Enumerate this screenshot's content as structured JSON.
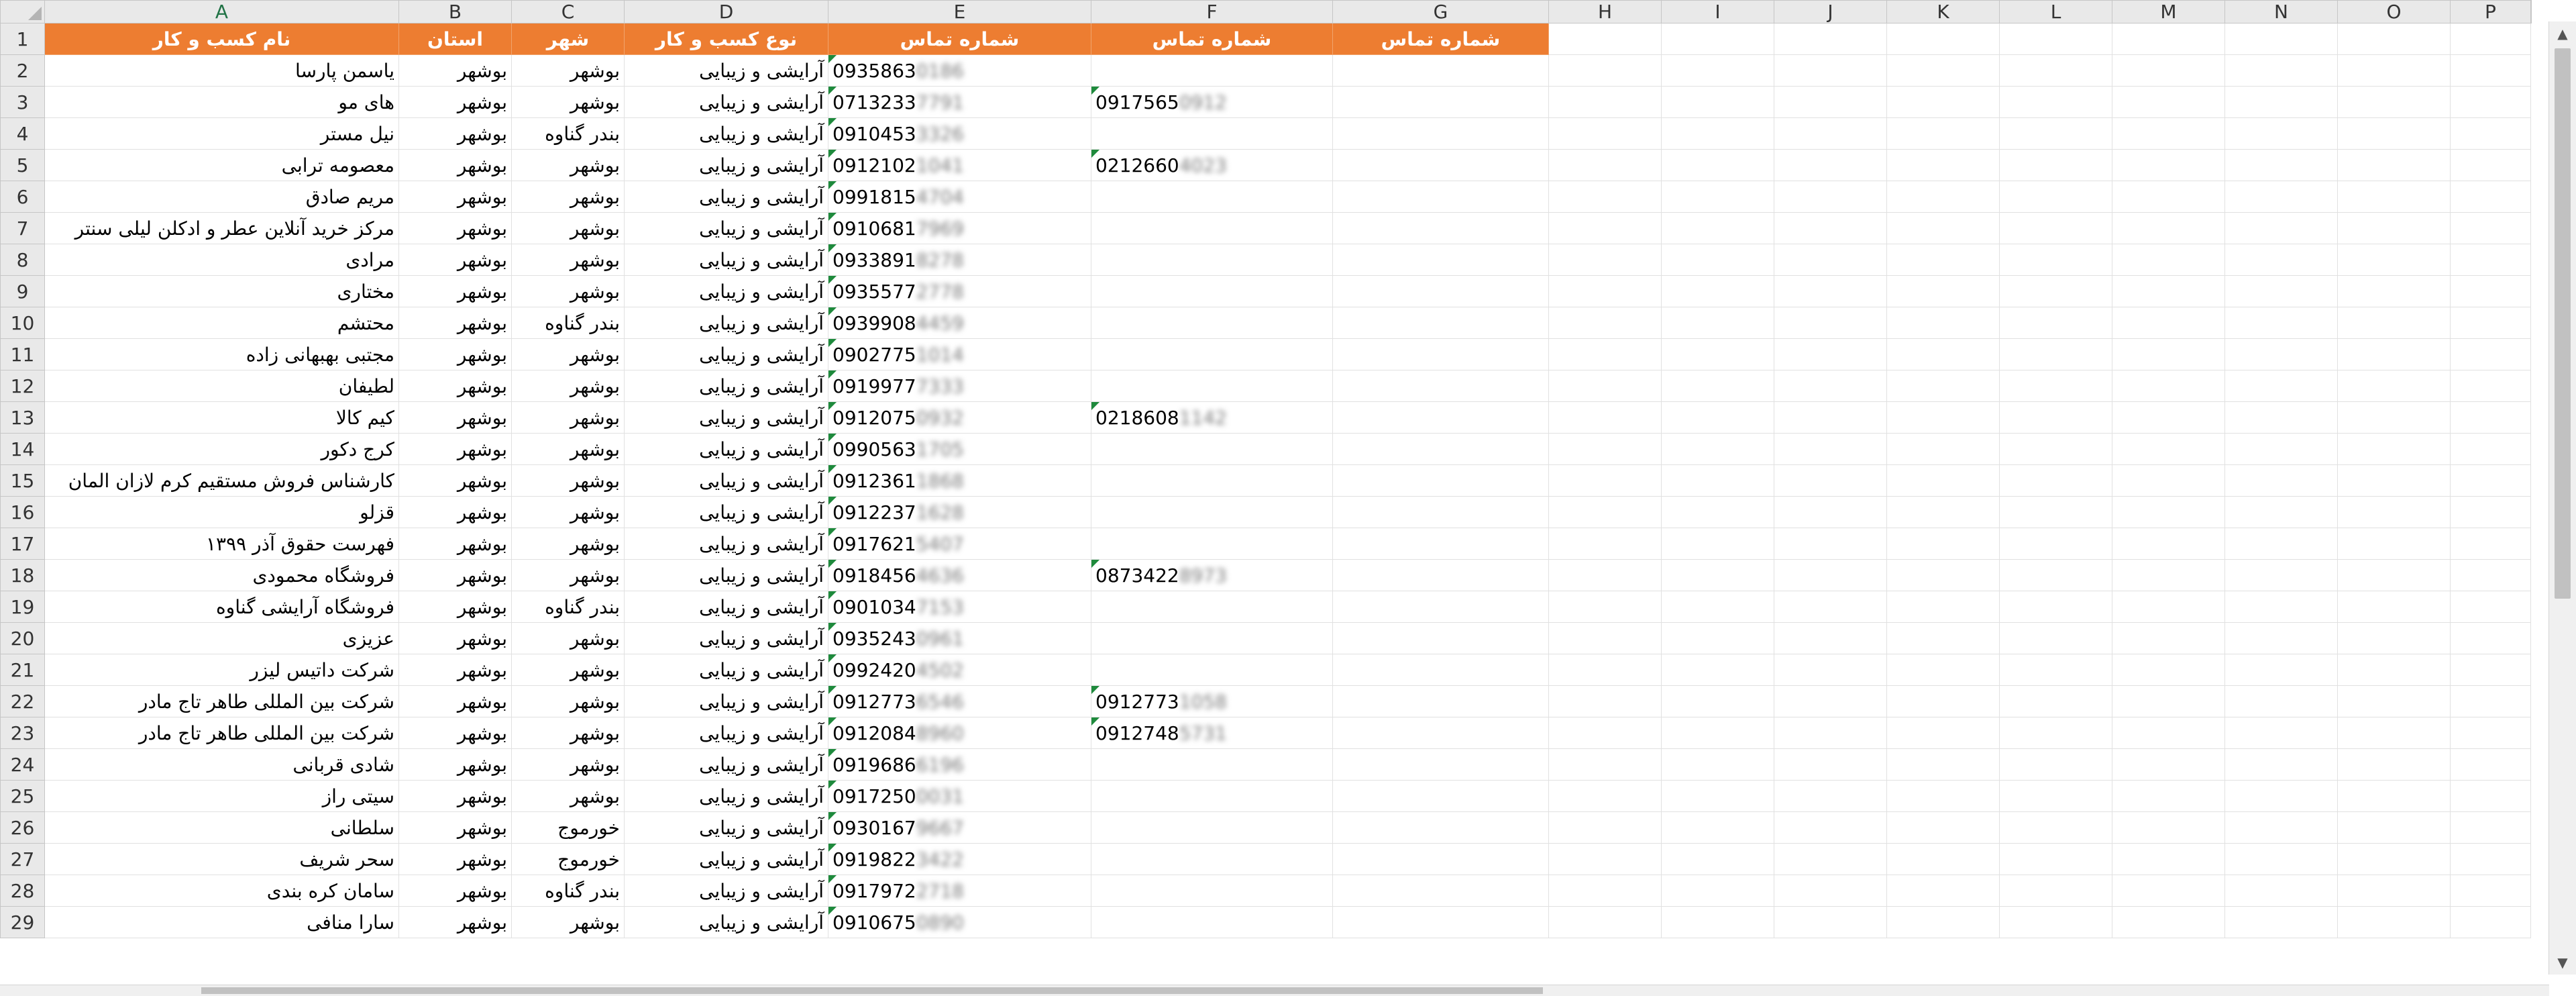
{
  "columns": [
    "A",
    "B",
    "C",
    "D",
    "E",
    "F",
    "G",
    "H",
    "I",
    "J",
    "K",
    "L",
    "M",
    "N",
    "O",
    "P"
  ],
  "header_row": {
    "row_number": "1",
    "A": "نام کسب و کار",
    "B": "استان",
    "C": "شهر",
    "D": "نوع کسب و کار",
    "E": "شماره تماس",
    "F": "شماره تماس",
    "G": "شماره تماس"
  },
  "rows": [
    {
      "n": "2",
      "A": "یاسمن پارسا",
      "B": "بوشهر",
      "C": "بوشهر",
      "D": "آرایشی و زیبایی",
      "E": "0935863",
      "E_hidden": "0186",
      "F": "",
      "F_hidden": ""
    },
    {
      "n": "3",
      "A": "های مو",
      "B": "بوشهر",
      "C": "بوشهر",
      "D": "آرایشی و زیبایی",
      "E": "0713233",
      "E_hidden": "7791",
      "F": "0917565",
      "F_hidden": "0912"
    },
    {
      "n": "4",
      "A": "نیل مستر",
      "B": "بوشهر",
      "C": "بندر گناوه",
      "D": "آرایشی و زیبایی",
      "E": "0910453",
      "E_hidden": "3326",
      "F": "",
      "F_hidden": ""
    },
    {
      "n": "5",
      "A": "معصومه ترابی",
      "B": "بوشهر",
      "C": "بوشهر",
      "D": "آرایشی و زیبایی",
      "E": "0912102",
      "E_hidden": "1041",
      "F": "0212660",
      "F_hidden": "4023"
    },
    {
      "n": "6",
      "A": "مریم صادق",
      "B": "بوشهر",
      "C": "بوشهر",
      "D": "آرایشی و زیبایی",
      "E": "0991815",
      "E_hidden": "4704",
      "F": "",
      "F_hidden": ""
    },
    {
      "n": "7",
      "A": "مرکز خرید آنلاین عطر و ادکلن لیلی سنتر",
      "B": "بوشهر",
      "C": "بوشهر",
      "D": "آرایشی و زیبایی",
      "E": "0910681",
      "E_hidden": "7969",
      "F": "",
      "F_hidden": ""
    },
    {
      "n": "8",
      "A": "مرادی",
      "B": "بوشهر",
      "C": "بوشهر",
      "D": "آرایشی و زیبایی",
      "E": "0933891",
      "E_hidden": "8278",
      "F": "",
      "F_hidden": ""
    },
    {
      "n": "9",
      "A": "مختاری",
      "B": "بوشهر",
      "C": "بوشهر",
      "D": "آرایشی و زیبایی",
      "E": "0935577",
      "E_hidden": "2778",
      "F": "",
      "F_hidden": ""
    },
    {
      "n": "10",
      "A": "محتشم",
      "B": "بوشهر",
      "C": "بندر گناوه",
      "D": "آرایشی و زیبایی",
      "E": "0939908",
      "E_hidden": "4459",
      "F": "",
      "F_hidden": ""
    },
    {
      "n": "11",
      "A": "مجتبی بهبهانی زاده",
      "B": "بوشهر",
      "C": "بوشهر",
      "D": "آرایشی و زیبایی",
      "E": "0902775",
      "E_hidden": "1014",
      "F": "",
      "F_hidden": ""
    },
    {
      "n": "12",
      "A": "لطیفان",
      "B": "بوشهر",
      "C": "بوشهر",
      "D": "آرایشی و زیبایی",
      "E": "0919977",
      "E_hidden": "7333",
      "F": "",
      "F_hidden": ""
    },
    {
      "n": "13",
      "A": "کیم کالا",
      "B": "بوشهر",
      "C": "بوشهر",
      "D": "آرایشی و زیبایی",
      "E": "0912075",
      "E_hidden": "0932",
      "F": "0218608",
      "F_hidden": "1142"
    },
    {
      "n": "14",
      "A": "کرج دکور",
      "B": "بوشهر",
      "C": "بوشهر",
      "D": "آرایشی و زیبایی",
      "E": "0990563",
      "E_hidden": "1705",
      "F": "",
      "F_hidden": ""
    },
    {
      "n": "15",
      "A": "کارشناس فروش مستقیم کرم لازان المان",
      "B": "بوشهر",
      "C": "بوشهر",
      "D": "آرایشی و زیبایی",
      "E": "0912361",
      "E_hidden": "1868",
      "F": "",
      "F_hidden": ""
    },
    {
      "n": "16",
      "A": "قزلو",
      "B": "بوشهر",
      "C": "بوشهر",
      "D": "آرایشی و زیبایی",
      "E": "0912237",
      "E_hidden": "1628",
      "F": "",
      "F_hidden": ""
    },
    {
      "n": "17",
      "A": "فهرست حقوق آذر ۱۳۹۹",
      "B": "بوشهر",
      "C": "بوشهر",
      "D": "آرایشی و زیبایی",
      "E": "0917621",
      "E_hidden": "5407",
      "F": "",
      "F_hidden": ""
    },
    {
      "n": "18",
      "A": "فروشگاه محمودی",
      "B": "بوشهر",
      "C": "بوشهر",
      "D": "آرایشی و زیبایی",
      "E": "0918456",
      "E_hidden": "4636",
      "F": "0873422",
      "F_hidden": "8973"
    },
    {
      "n": "19",
      "A": "فروشگاه آرایشی گناوه",
      "B": "بوشهر",
      "C": "بندر گناوه",
      "D": "آرایشی و زیبایی",
      "E": "0901034",
      "E_hidden": "7153",
      "F": "",
      "F_hidden": ""
    },
    {
      "n": "20",
      "A": "عزیزی",
      "B": "بوشهر",
      "C": "بوشهر",
      "D": "آرایشی و زیبایی",
      "E": "0935243",
      "E_hidden": "0961",
      "F": "",
      "F_hidden": ""
    },
    {
      "n": "21",
      "A": "شرکت داتیس لیزر",
      "B": "بوشهر",
      "C": "بوشهر",
      "D": "آرایشی و زیبایی",
      "E": "0992420",
      "E_hidden": "4502",
      "F": "",
      "F_hidden": ""
    },
    {
      "n": "22",
      "A": "شرکت بین المللی طاهر تاج مادر",
      "B": "بوشهر",
      "C": "بوشهر",
      "D": "آرایشی و زیبایی",
      "E": "0912773",
      "E_hidden": "6546",
      "F": "0912773",
      "F_hidden": "1058"
    },
    {
      "n": "23",
      "A": "شرکت بین المللی طاهر تاج مادر",
      "B": "بوشهر",
      "C": "بوشهر",
      "D": "آرایشی و زیبایی",
      "E": "0912084",
      "E_hidden": "8960",
      "F": "0912748",
      "F_hidden": "5731"
    },
    {
      "n": "24",
      "A": "شادی قربانی",
      "B": "بوشهر",
      "C": "بوشهر",
      "D": "آرایشی و زیبایی",
      "E": "0919686",
      "E_hidden": "6196",
      "F": "",
      "F_hidden": ""
    },
    {
      "n": "25",
      "A": "سیتی راز",
      "B": "بوشهر",
      "C": "بوشهر",
      "D": "آرایشی و زیبایی",
      "E": "0917250",
      "E_hidden": "0031",
      "F": "",
      "F_hidden": ""
    },
    {
      "n": "26",
      "A": "سلطانی",
      "B": "بوشهر",
      "C": "خورموج",
      "D": "آرایشی و زیبایی",
      "E": "0930167",
      "E_hidden": "9667",
      "F": "",
      "F_hidden": ""
    },
    {
      "n": "27",
      "A": "سحر شریف",
      "B": "بوشهر",
      "C": "خورموج",
      "D": "آرایشی و زیبایی",
      "E": "0919822",
      "E_hidden": "3422",
      "F": "",
      "F_hidden": ""
    },
    {
      "n": "28",
      "A": "سامان کره بندی",
      "B": "بوشهر",
      "C": "بندر گناوه",
      "D": "آرایشی و زیبایی",
      "E": "0917972",
      "E_hidden": "2718",
      "F": "",
      "F_hidden": ""
    },
    {
      "n": "29",
      "A": "سارا منافی",
      "B": "بوشهر",
      "C": "بوشهر",
      "D": "آرایشی و زیبایی",
      "E": "0910675",
      "E_hidden": "0890",
      "F": "",
      "F_hidden": ""
    }
  ],
  "colors": {
    "header_fill": "#ed7d31",
    "header_text": "#ffffff",
    "comment_marker": "#1e8a3c"
  }
}
